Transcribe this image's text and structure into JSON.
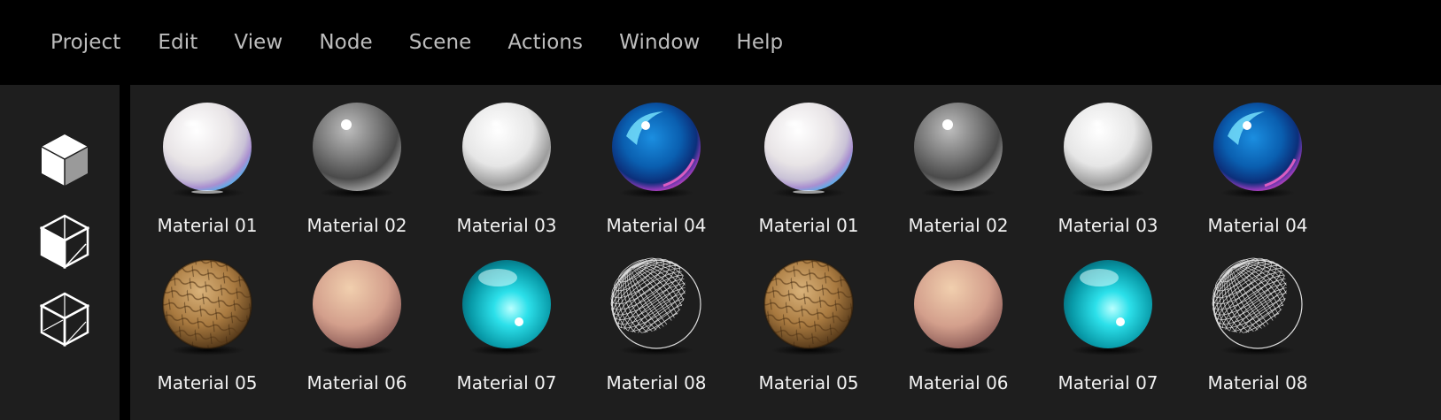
{
  "menu": [
    "Project",
    "Edit",
    "View",
    "Node",
    "Scene",
    "Actions",
    "Window",
    "Help"
  ],
  "sidebar": {
    "items": [
      {
        "name": "solid-cube-icon"
      },
      {
        "name": "shaded-cube-icon"
      },
      {
        "name": "wireframe-cube-icon"
      }
    ]
  },
  "materials": [
    {
      "label": "Material 01",
      "style": "pearl"
    },
    {
      "label": "Material 02",
      "style": "chrome"
    },
    {
      "label": "Material 03",
      "style": "white"
    },
    {
      "label": "Material 04",
      "style": "blue-glass"
    },
    {
      "label": "Material 01",
      "style": "pearl"
    },
    {
      "label": "Material 02",
      "style": "chrome"
    },
    {
      "label": "Material 03",
      "style": "white"
    },
    {
      "label": "Material 04",
      "style": "blue-glass"
    },
    {
      "label": "Material 05",
      "style": "wood"
    },
    {
      "label": "Material 06",
      "style": "skin"
    },
    {
      "label": "Material 07",
      "style": "cyan-glass"
    },
    {
      "label": "Material 08",
      "style": "wireframe"
    },
    {
      "label": "Material 05",
      "style": "wood"
    },
    {
      "label": "Material 06",
      "style": "skin"
    },
    {
      "label": "Material 07",
      "style": "cyan-glass"
    },
    {
      "label": "Material 08",
      "style": "wireframe"
    }
  ],
  "colors": {
    "menubar_bg": "#000000",
    "panel_bg": "#1e1e1e",
    "menu_text": "#bdbdbd",
    "label_text": "#f2f2f2"
  }
}
